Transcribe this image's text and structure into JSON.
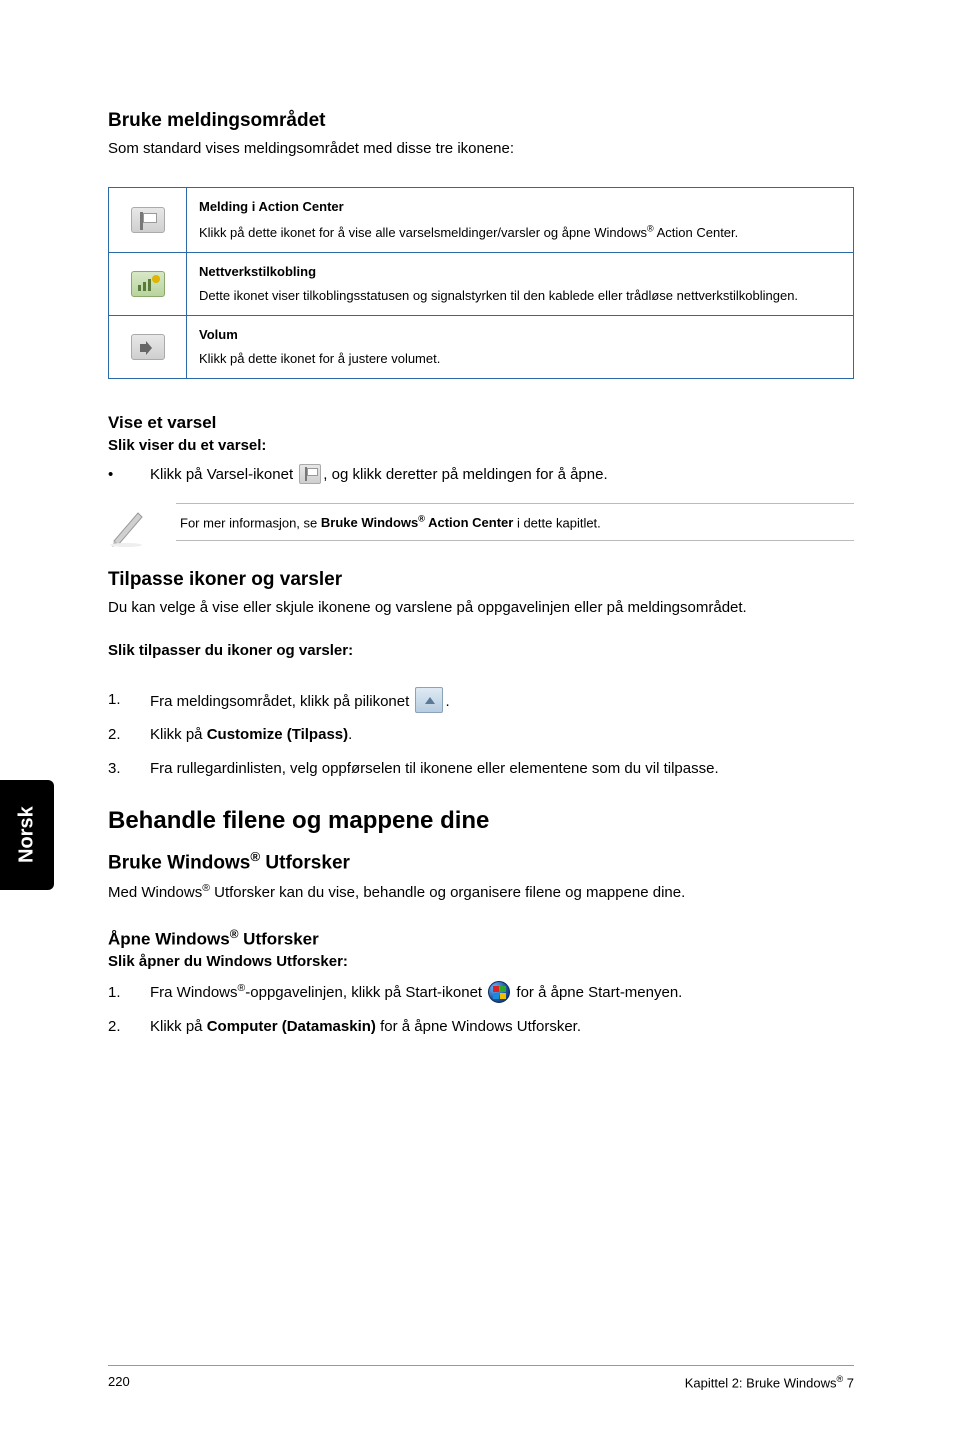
{
  "side_tab": "Norsk",
  "sec1": {
    "title": "Bruke meldingsområdet",
    "intro": "Som standard vises meldingsområdet med disse tre ikonene:"
  },
  "table": {
    "rows": [
      {
        "title": "Melding i Action Center",
        "desc_a": "Klikk på dette ikonet for å vise alle varselsmeldinger/varsler og åpne Windows",
        "desc_b": " Action Center."
      },
      {
        "title": "Nettverkstilkobling",
        "desc": "Dette ikonet viser tilkoblingsstatusen og signalstyrken til den kablede eller trådløse nettverkstilkoblingen."
      },
      {
        "title": "Volum",
        "desc": "Klikk på dette ikonet for å justere volumet."
      }
    ]
  },
  "varsel": {
    "title": "Vise et varsel",
    "sub": "Slik viser du et varsel:",
    "bullet_a": "Klikk på Varsel-ikonet ",
    "bullet_b": ", og klikk deretter på meldingen for å åpne."
  },
  "note": {
    "pre": "For mer informasjon, se ",
    "bold_a": "Bruke Windows",
    "bold_b": " Action Center",
    "post": " i dette kapitlet."
  },
  "tilpasse": {
    "title": "Tilpasse ikoner og varsler",
    "intro": "Du kan velge å vise eller skjule ikonene og varslene på oppgavelinjen eller på meldingsområdet.",
    "sub": "Slik tilpasser du ikoner og varsler:",
    "step1_a": "Fra meldingsområdet, klikk på pilikonet ",
    "step1_b": ".",
    "step2_a": "Klikk på ",
    "step2_bold": "Customize (Tilpass)",
    "step2_b": ".",
    "step3": "Fra rullegardinlisten, velg oppførselen til ikonene eller elementene som du vil tilpasse."
  },
  "sec2": {
    "title": "Behandle filene og mappene dine"
  },
  "utforsker": {
    "title_a": "Bruke Windows",
    "title_b": " Utforsker",
    "intro_a": "Med Windows",
    "intro_b": " Utforsker kan du vise, behandle og organisere filene og mappene dine."
  },
  "apne": {
    "title_a": "Åpne Windows",
    "title_b": " Utforsker",
    "sub": "Slik åpner du Windows Utforsker:",
    "step1_a": "Fra Windows",
    "step1_b": "-oppgavelinjen, klikk på Start-ikonet ",
    "step1_c": " for å åpne Start-menyen.",
    "step2_a": "Klikk på ",
    "step2_bold": "Computer (Datamaskin)",
    "step2_b": " for å åpne Windows Utforsker."
  },
  "footer": {
    "page": "220",
    "chapter_a": "Kapittel 2: Bruke Windows",
    "chapter_b": " 7"
  },
  "reg": "®"
}
